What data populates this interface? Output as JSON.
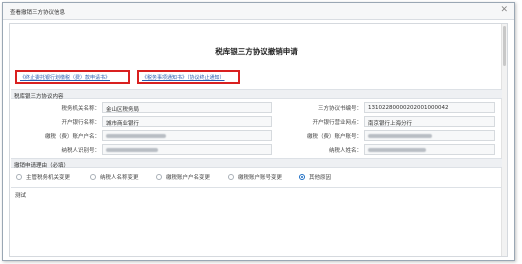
{
  "window": {
    "title": "查看撤销三方协议信息",
    "close_glyph": "✕"
  },
  "heading": "税库银三方协议撤销申请",
  "links": {
    "link1": "《终止委托银行划缴税（费）款申请书》",
    "link2": "《税务事项通知书》（协议终止通知）"
  },
  "agreement_section": {
    "title": "税库银三方协议内容",
    "labels": {
      "tax_authority": "税务机关名称：",
      "bank": "开户银行名称：",
      "account_name": "缴税（费）账户户名：",
      "taxpayer_id": "纳税人识别号：",
      "agreement_no": "三方协议书编号：",
      "bank_branch": "开户银行营业网点：",
      "account_no": "缴税（费）账户账号：",
      "taxpayer_name": "纳税人姓名："
    },
    "values": {
      "tax_authority": "金山区税务局",
      "bank": "城市商业银行",
      "agreement_no": "13102280000202001000042",
      "bank_branch": "南京银行上海分行"
    }
  },
  "reason_section": {
    "title": "撤销申请理由（必填）",
    "options": [
      "主管税务机关变更",
      "纳税人名称变更",
      "缴税账户户名变更",
      "缴税账户账号变更",
      "其他原因"
    ],
    "selected_index": 4,
    "text": "测试"
  }
}
